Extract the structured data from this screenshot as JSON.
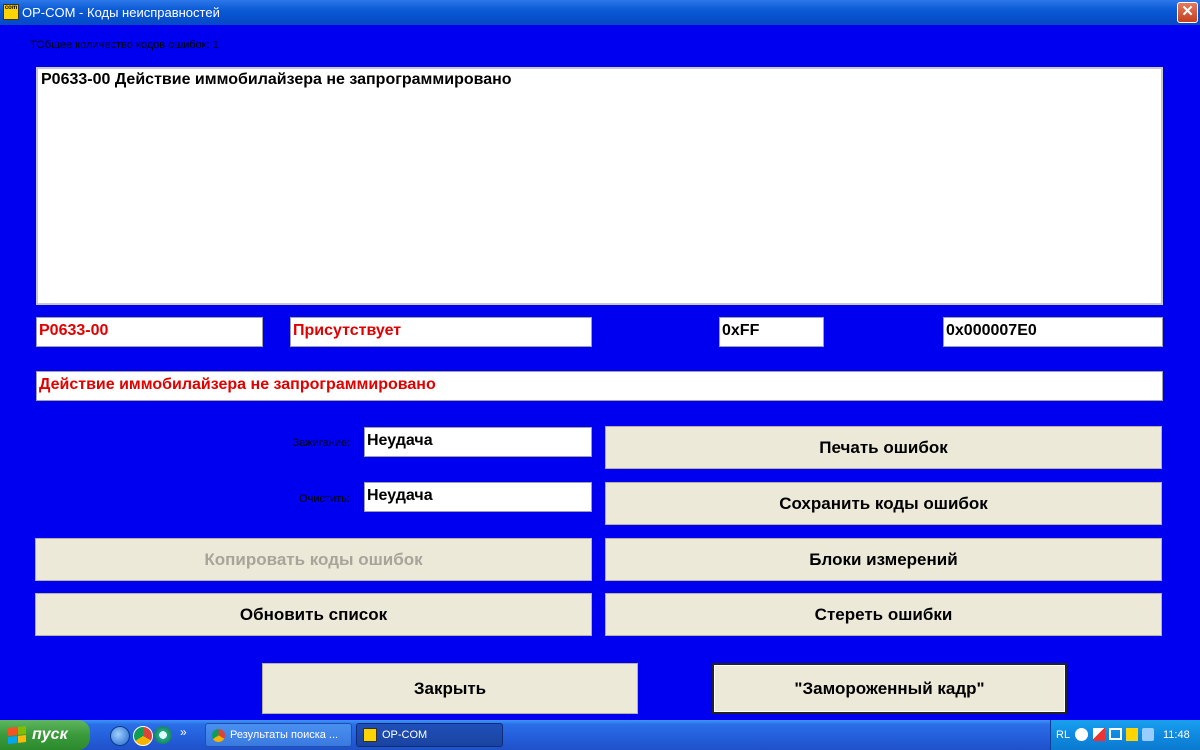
{
  "window": {
    "title": "OP-COM - Коды неисправностей",
    "icon_text": "com",
    "close_glyph": "✕"
  },
  "main": {
    "count_label": "ТОбщее количество кодов ошибок:  1",
    "codes_list": [
      "P0633-00 Действие иммобилайзера не запрограммировано"
    ],
    "fields": {
      "code": "P0633-00",
      "status": "Присутствует",
      "hex1": "0xFF",
      "hex2": "0x000007E0",
      "description": "Действие иммобилайзера не запрограммировано"
    },
    "ignition": {
      "label": "Зажигание:",
      "value": "Неудача"
    },
    "clear": {
      "label": "Очистить:",
      "value": "Неудача"
    },
    "buttons": {
      "print": "Печать ошибок",
      "save": "Сохранить коды ошибок",
      "copy": "Копировать коды ошибок",
      "blocks": "Блоки измерений",
      "refresh": "Обновить список",
      "erase": "Стереть ошибки",
      "close": "Закрыть",
      "freeze": "\"Замороженный кадр\""
    }
  },
  "taskbar": {
    "start_label": "пуск",
    "chevron": "»",
    "tasks": [
      {
        "label": "Результаты поиска ...",
        "icon": "chrome-icon"
      },
      {
        "label": "OP-COM",
        "icon": "opcom-icon"
      }
    ],
    "tray_lang": "RL",
    "clock": "11:48"
  },
  "colors": {
    "background": "#0000f0",
    "error_text": "#e00000",
    "button_face": "#ece9d8"
  }
}
